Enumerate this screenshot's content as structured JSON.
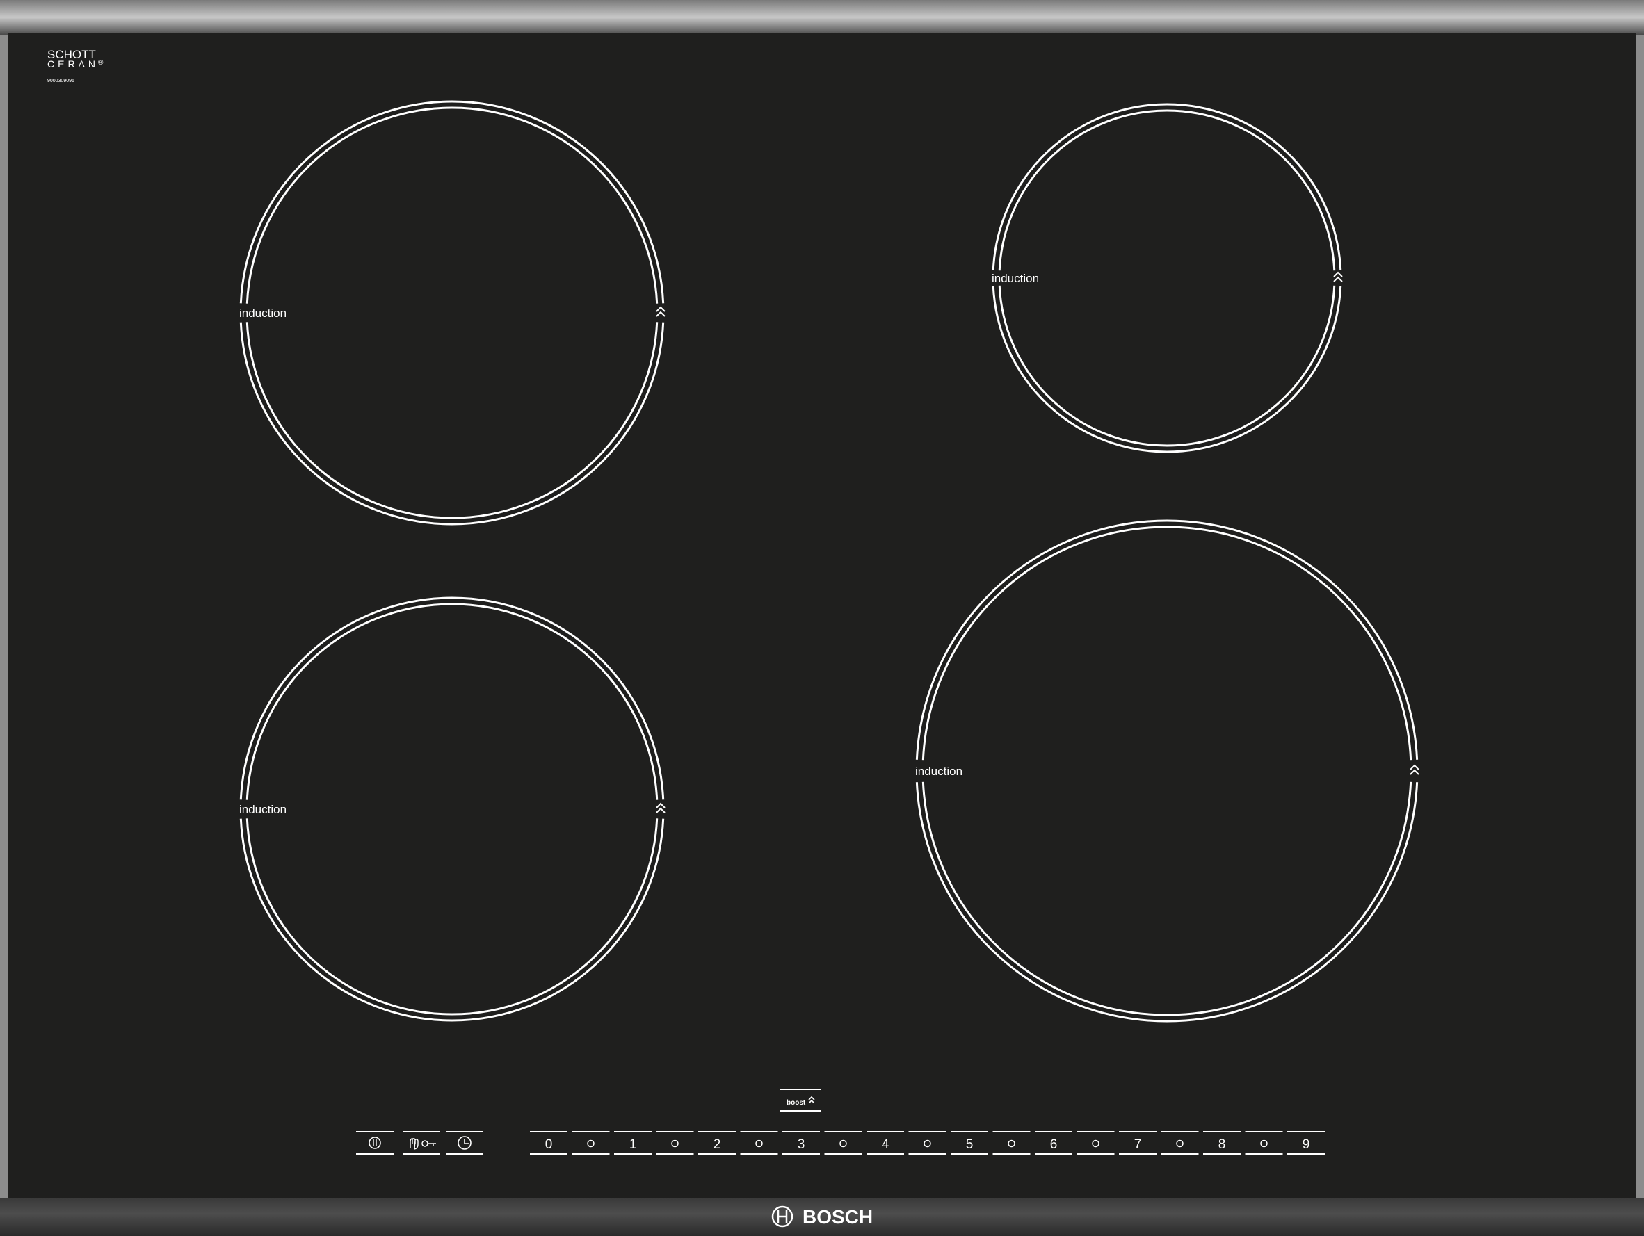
{
  "brand": {
    "glass_line1": "SCHOTT",
    "glass_line2": "CERAN",
    "registered": "®",
    "serial": "9000309096",
    "maker": "BOSCH"
  },
  "zones": [
    {
      "id": "front-left-top",
      "label": "induction",
      "boost_icon": "double-chevron-up-icon"
    },
    {
      "id": "front-left-bottom",
      "label": "induction",
      "boost_icon": "double-chevron-up-icon"
    },
    {
      "id": "rear-right-small",
      "label": "induction",
      "boost_icon": "double-chevron-up-icon"
    },
    {
      "id": "front-right-large",
      "label": "induction",
      "boost_icon": "double-chevron-up-icon"
    }
  ],
  "controls": {
    "boost_label": "boost",
    "power_icon": "power-icon",
    "lock_icon": "child-lock-icon",
    "timer_icon": "timer-clock-icon",
    "levels": [
      "0",
      "1",
      "2",
      "3",
      "4",
      "5",
      "6",
      "7",
      "8",
      "9"
    ],
    "half_step_icon": "small-circle-icon"
  },
  "colors": {
    "glass": "#1f1f1e",
    "frame": "#9a9a9a",
    "print": "#ffffff"
  }
}
